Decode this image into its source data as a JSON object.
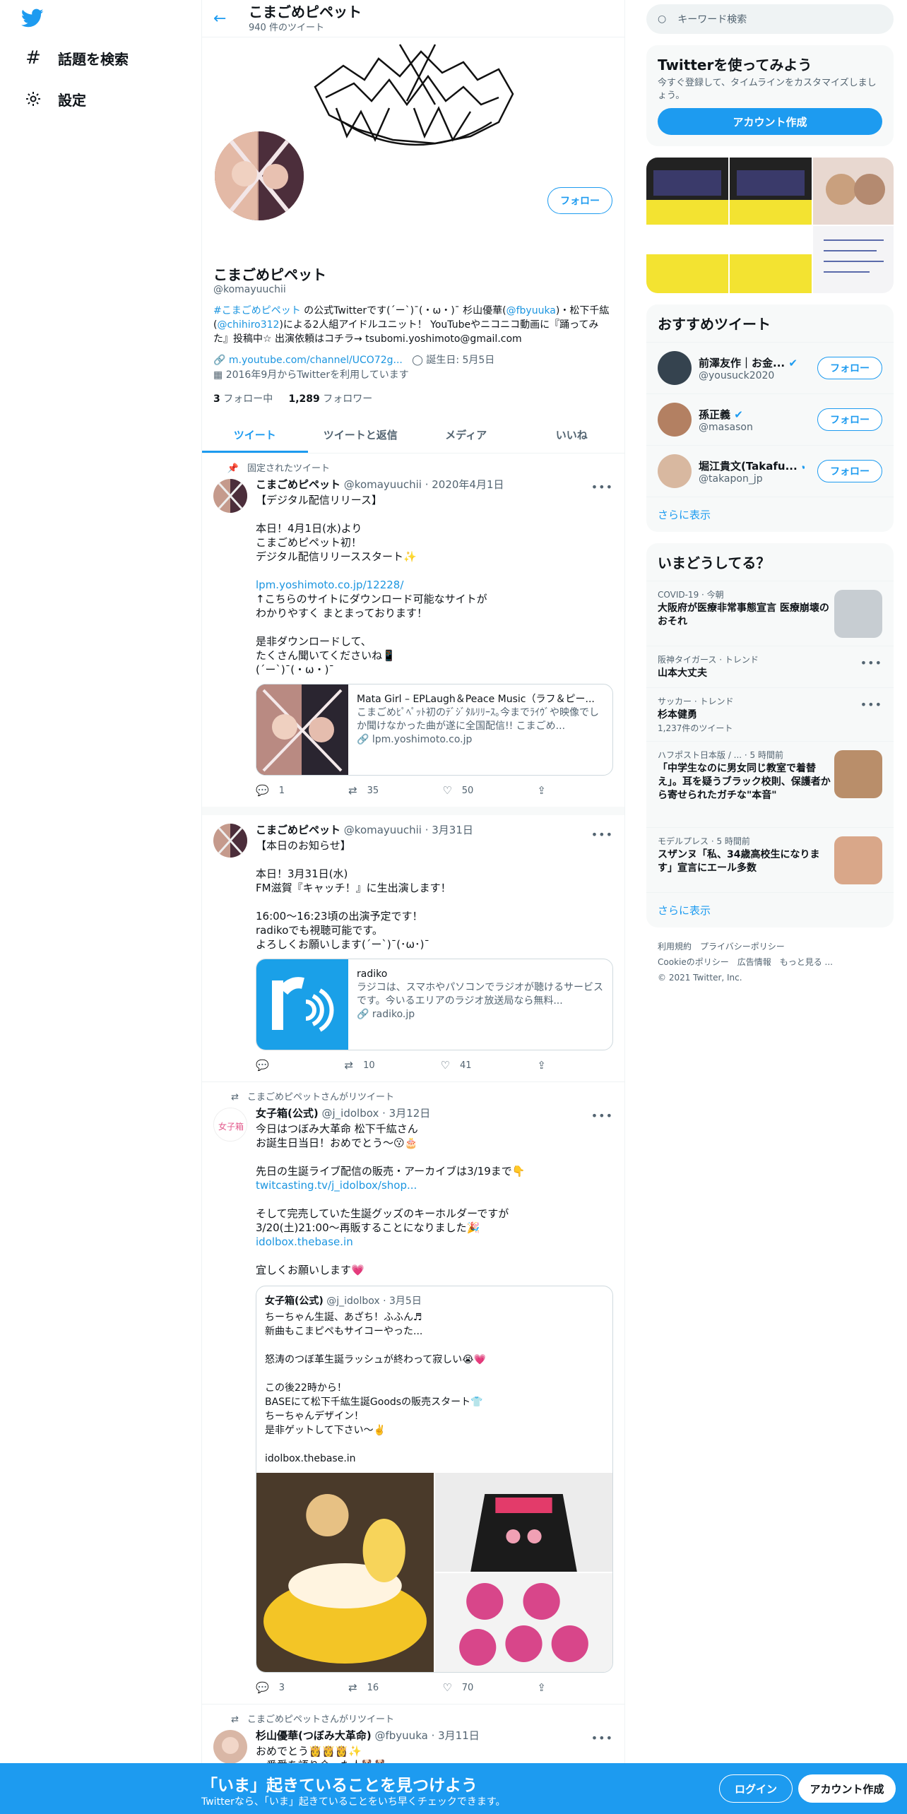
{
  "nav": {
    "explore": "話題を検索",
    "settings": "設定"
  },
  "header": {
    "title": "こまごめピペット",
    "tweet_count": "940 件のツイート"
  },
  "profile": {
    "name": "こまごめピペット",
    "handle": "@komayuuchii",
    "follow": "フォロー",
    "bio_link1": "#こまごめピペット",
    "bio_t1": " の公式Twitterです(´ー`)¯(・ω・)¯ 杉山優華(",
    "bio_link2": "@fbyuuka",
    "bio_t2": ")・松下千紘(",
    "bio_link3": "@chihiro312",
    "bio_t3": ")による2人組アイドルユニット！ YouTubeやニコニコ動画に『踊ってみた』投稿中☆ 出演依頼はコチラ→ tsubomi.yoshimoto@gmail.com",
    "url": "m.youtube.com/channel/UCO72g...",
    "birthday": "誕生日: 5月5日",
    "joined": "2016年9月からTwitterを利用しています",
    "following_count": "3",
    "following_label": "フォロー中",
    "followers_count": "1,289",
    "followers_label": "フォロワー"
  },
  "tabs": [
    "ツイート",
    "ツイートと返信",
    "メディア",
    "いいね"
  ],
  "tweets": [
    {
      "context": "固定されたツイート",
      "name": "こまごめピペット",
      "handle": "@komayuuchii",
      "date": "· 2020年4月1日",
      "text1": "【デジタル配信リリース】\n\n本日！4月1日(水)より\nこまごめピペット初！\nデジタル配信リリーススタート✨\n\n",
      "link": "lpm.yoshimoto.co.jp/12228/",
      "text2": "\n↑こちらのサイトにダウンロード可能なサイトが\nわかりやすく まとまっております！\n\n是非ダウンロードして、\nたくさん聞いてくださいね📱\n(´ー`)¯(・ω・)¯",
      "card_title": "Mata Girl – EPLaugh＆Peace Music（ラフ＆ピー...",
      "card_desc": "こまごめﾋﾟﾍﾟｯﾄ初のﾃﾞｼﾞﾀﾙﾘﾘｰｽ｡今までﾗｲｳﾞや映像でしか聞けなかった曲が遂に全国配信!! こまごめ...",
      "card_domain": "lpm.yoshimoto.co.jp",
      "replies": "1",
      "retweets": "35",
      "likes": "50"
    },
    {
      "name": "こまごめピペット",
      "handle": "@komayuuchii",
      "date": "· 3月31日",
      "text1": "【本日のお知らせ】\n\n本日！3月31日(水)\nFM滋賀『キャッチ！』に生出演します！\n\n16:00～16:23頃の出演予定です！\nradikoでも視聴可能です。\nよろしくお願いします(´ー`)¯(･ω･)¯",
      "card_title": "radiko",
      "card_desc": "ラジコは、スマホやパソコンでラジオが聴けるサービスです。今いるエリアのラジオ放送局なら無料...",
      "card_domain": "radiko.jp",
      "replies": "",
      "retweets": "10",
      "likes": "41"
    },
    {
      "context": "こまごめピペットさんがリツイート",
      "name": "女子箱(公式)",
      "handle": "@j_idolbox",
      "date": "· 3月12日",
      "text1": "今日はつぼみ大革命 松下千紘さん\nお誕生日当日！おめでとう〜😗🎂\n\n先日の生誕ライブ配信の販売・アーカイブは3/19まで👇\n",
      "link": "twitcasting.tv/j_idolbox/shop...",
      "text2": "\n\nそして完売していた生誕グッズのキーホルダーですが\n3/20(土)21:00〜再販することになりました🎉\n",
      "link2": "idolbox.thebase.in",
      "text3": "\n\n宜しくお願いします💗",
      "quote_name": "女子箱(公式)",
      "quote_handle": "@j_idolbox · 3月5日",
      "quote_text": "ちーちゃん生誕、あざち！ふふん♬\n新曲もこまピペもサイコーやった...\n\n怒涛のつぼ革生誕ラッシュが終わって寂しい😭💗\n\nこの後22時から！\nBASEにて松下千紘生誕Goodsの販売スタート👕\nちーちゃんデザイン！\n是非ゲットして下さい〜✌️\n\nidolbox.thebase.in",
      "replies": "3",
      "retweets": "16",
      "likes": "70"
    },
    {
      "context": "こまごめピペットさんがリツイート",
      "name": "杉山優華(つぼみ大革命)",
      "handle": "@fbyuuka",
      "date": "· 3月11日",
      "text1": "おめでとう👸👸👸✨\n一番愛を語り合った人🐕🐕"
    }
  ],
  "right": {
    "search_placeholder": "キーワード検索",
    "signup_title": "Twitterを使ってみよう",
    "signup_sub": "今すぐ登録して、タイムラインをカスタマイズしましょう。",
    "signup_btn": "アカウント作成",
    "rec_title": "おすすめツイート",
    "rec": [
      {
        "name": "前澤友作｜お金...",
        "handle": "@yousuck2020"
      },
      {
        "name": "孫正義",
        "handle": "@masason"
      },
      {
        "name": "堀江貴文(Takafu...",
        "handle": "@takapon_jp"
      }
    ],
    "follow": "フォロー",
    "show_more": "さらに表示",
    "trends_title": "いまどうしてる？",
    "trends": [
      {
        "meta": "COVID-19 · 今朝",
        "title": "大阪府が医療非常事態宣言 医療崩壊のおそれ"
      },
      {
        "meta": "阪神タイガース · トレンド",
        "title": "山本大丈夫"
      },
      {
        "meta": "サッカー · トレンド",
        "title": "杉本健勇",
        "count": "1,237件のツイート"
      },
      {
        "meta": "ハフポスト日本版 / ... · 5 時間前",
        "title": "「中学生なのに男女同じ教室で着替え」。耳を疑うブラック校則、保護者から寄せられたガチな\"本音\""
      },
      {
        "meta": "モデルプレス · 5 時間前",
        "title": "スザンヌ「私、34歳高校生になります」宣言にエール多数"
      }
    ],
    "footer1": "利用規約　プライバシーポリシー",
    "footer2": "Cookieのポリシー　広告情報　もっと見る ...",
    "footer3": "© 2021 Twitter, Inc."
  },
  "bottom": {
    "title": "「いま」起きていることを見つけよう",
    "sub": "Twitterなら、「いま」起きていることをいち早くチェックできます。",
    "login": "ログイン",
    "signup": "アカウント作成"
  },
  "colors": {
    "accent": "#1d9bf0",
    "text": "#0f1419",
    "muted": "#536471"
  }
}
